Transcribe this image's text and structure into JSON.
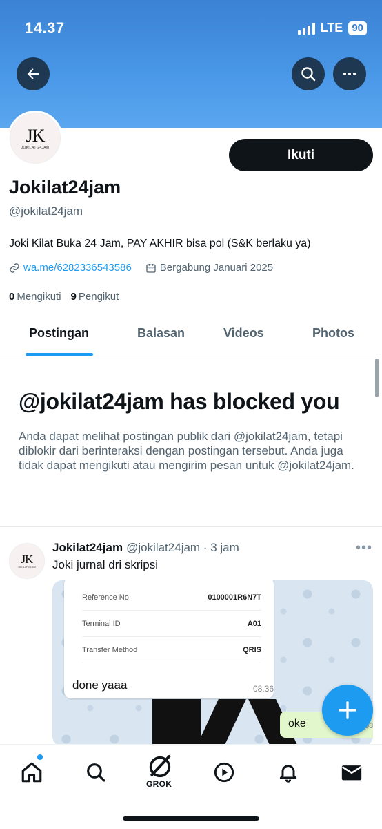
{
  "status_bar": {
    "time": "14.37",
    "network": "LTE",
    "battery": "90"
  },
  "header": {
    "back_icon": "arrow-left-icon",
    "search_icon": "search-icon",
    "more_icon": "more-horizontal-icon"
  },
  "profile": {
    "avatar_logo": "JK",
    "avatar_sub": "JOKILAT 24JAM",
    "follow_label": "Ikuti",
    "name": "Jokilat24jam",
    "handle": "@jokilat24jam",
    "bio": "Joki Kilat Buka 24 Jam, PAY AKHIR bisa pol (S&K berlaku ya)",
    "link": "wa.me/6282336543586",
    "joined": "Bergabung Januari 2025",
    "following_count": "0",
    "following_label": "Mengikuti",
    "followers_count": "9",
    "followers_label": "Pengikut"
  },
  "tabs": [
    {
      "label": "Postingan",
      "active": true
    },
    {
      "label": "Balasan",
      "active": false
    },
    {
      "label": "Videos",
      "active": false
    },
    {
      "label": "Photos",
      "active": false
    }
  ],
  "blocked": {
    "title": "@jokilat24jam has blocked you",
    "text": "Anda dapat melihat postingan publik dari @jokilat24jam, tetapi diblokir dari berinteraksi dengan postingan tersebut. Anda juga tidak dapat mengikuti atau mengirim pesan untuk @jokilat24jam."
  },
  "post": {
    "name": "Jokilat24jam",
    "handle_time": "@jokilat24jam · 3 jam",
    "text": "Joki jurnal dri skripsi",
    "media": {
      "rows": [
        {
          "label": "Reference No.",
          "value": "0100001R6N7T"
        },
        {
          "label": "Terminal ID",
          "value": "A01"
        },
        {
          "label": "Transfer Method",
          "value": "QRIS"
        }
      ],
      "message": "done yaaa",
      "message_time": "08.36",
      "reply": "oke",
      "reply_time": "08.3"
    }
  },
  "fab": {
    "icon": "plus-icon"
  },
  "bottom_nav": {
    "items": [
      "home-icon",
      "search-icon",
      "grok-icon",
      "video-play-icon",
      "bell-icon",
      "mail-icon"
    ],
    "grok_label": "GROK"
  },
  "colors": {
    "accent": "#1d9bf0",
    "banner": "#4a98e8",
    "text": "#0f1419",
    "muted": "#536471"
  }
}
